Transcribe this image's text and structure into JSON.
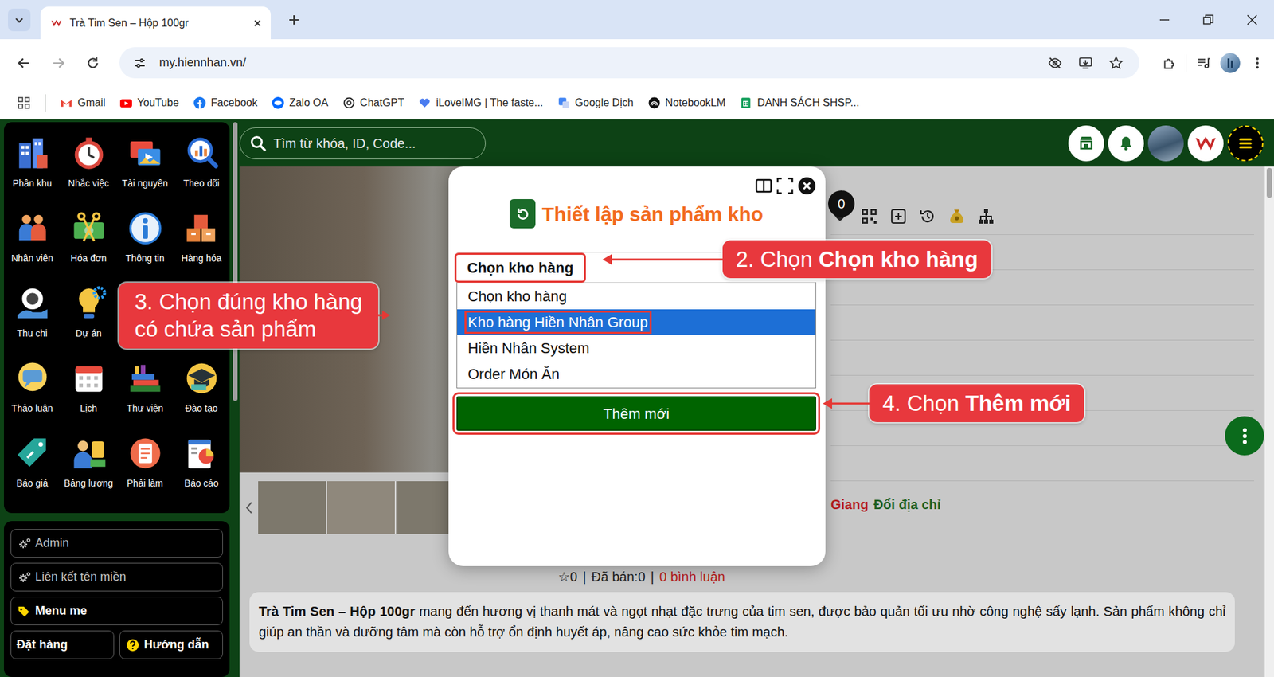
{
  "browser": {
    "tab": {
      "title": "Trà Tim Sen – Hộp 100gr",
      "selected": true
    },
    "url": "my.hiennhan.vn/",
    "bookmarks": [
      {
        "label": "Gmail"
      },
      {
        "label": "YouTube"
      },
      {
        "label": "Facebook"
      },
      {
        "label": "Zalo OA"
      },
      {
        "label": "ChatGPT"
      },
      {
        "label": "iLoveIMG | The faste..."
      },
      {
        "label": "Google Dịch"
      },
      {
        "label": "NotebookLM"
      },
      {
        "label": "DANH SÁCH SHSP..."
      }
    ]
  },
  "sidebar": {
    "apps": [
      [
        {
          "label": "Phân khu"
        },
        {
          "label": "Nhắc việc"
        },
        {
          "label": "Tài nguyên"
        },
        {
          "label": "Theo dõi"
        }
      ],
      [
        {
          "label": "Nhân viên"
        },
        {
          "label": "Hóa đơn"
        },
        {
          "label": "Thông tin"
        },
        {
          "label": "Hàng hóa"
        }
      ],
      [
        {
          "label": "Thu chi"
        },
        {
          "label": "Dự án"
        }
      ],
      [
        {
          "label": "Thảo luận"
        },
        {
          "label": "Lịch"
        },
        {
          "label": "Thư viện"
        },
        {
          "label": "Đào tạo"
        }
      ],
      [
        {
          "label": "Báo giá"
        },
        {
          "label": "Bảng lương"
        },
        {
          "label": "Phải làm"
        },
        {
          "label": "Báo cáo"
        }
      ]
    ],
    "menu": [
      {
        "label": "Admin",
        "kind": "gear"
      },
      {
        "label": "Liên kết tên miền",
        "kind": "gear"
      },
      {
        "label": "Menu me",
        "kind": "tag"
      },
      {
        "label": "Đặt hàng",
        "kind": "plain"
      },
      {
        "label": "Hướng dẫn",
        "kind": "help"
      }
    ]
  },
  "topbar": {
    "search_placeholder": "Tìm từ khóa, ID, Code..."
  },
  "product": {
    "cart_count": "0",
    "location": "Giang",
    "change_address": "Đổi địa chỉ",
    "stats": {
      "star": "☆",
      "rating": "0",
      "separator": "|",
      "sold": "Đã bán:0",
      "comments": "0 bình luận"
    },
    "description": {
      "title": "Trà Tim Sen – Hộp 100gr",
      "body": " mang đến hương vị thanh mát và ngọt nhạt đặc trưng của tim sen, được bảo quản tối ưu nhờ công nghệ sấy lạnh. Sản phẩm không chỉ giúp an thần và dưỡng tâm mà còn hỗ trợ ổn định huyết áp, nâng cao sức khỏe tim mạch."
    }
  },
  "modal": {
    "title": "Thiết lập sản phẩm kho",
    "select_value": "Chọn kho hàng",
    "options": [
      {
        "label": "Chọn kho hàng",
        "selected": false
      },
      {
        "label": "Kho hàng Hiền Nhân Group",
        "selected": true
      },
      {
        "label": "Hiền Nhân System",
        "selected": false
      },
      {
        "label": "Order Món Ăn",
        "selected": false
      }
    ],
    "button": "Thêm mới"
  },
  "annotations": [
    {
      "lines": [
        [
          {
            "text": "2. Chọn ",
            "bold": false
          },
          {
            "text": "Chọn kho hàng",
            "bold": true
          }
        ]
      ]
    },
    {
      "lines": [
        [
          {
            "text": "3. Chọn đúng kho hàng",
            "bold": false
          }
        ],
        [
          {
            "text": "có chứa sản phẩm",
            "bold": false
          }
        ]
      ]
    },
    {
      "lines": [
        [
          {
            "text": "4. Chọn ",
            "bold": false
          },
          {
            "text": "Thêm mới",
            "bold": true
          }
        ]
      ]
    }
  ]
}
